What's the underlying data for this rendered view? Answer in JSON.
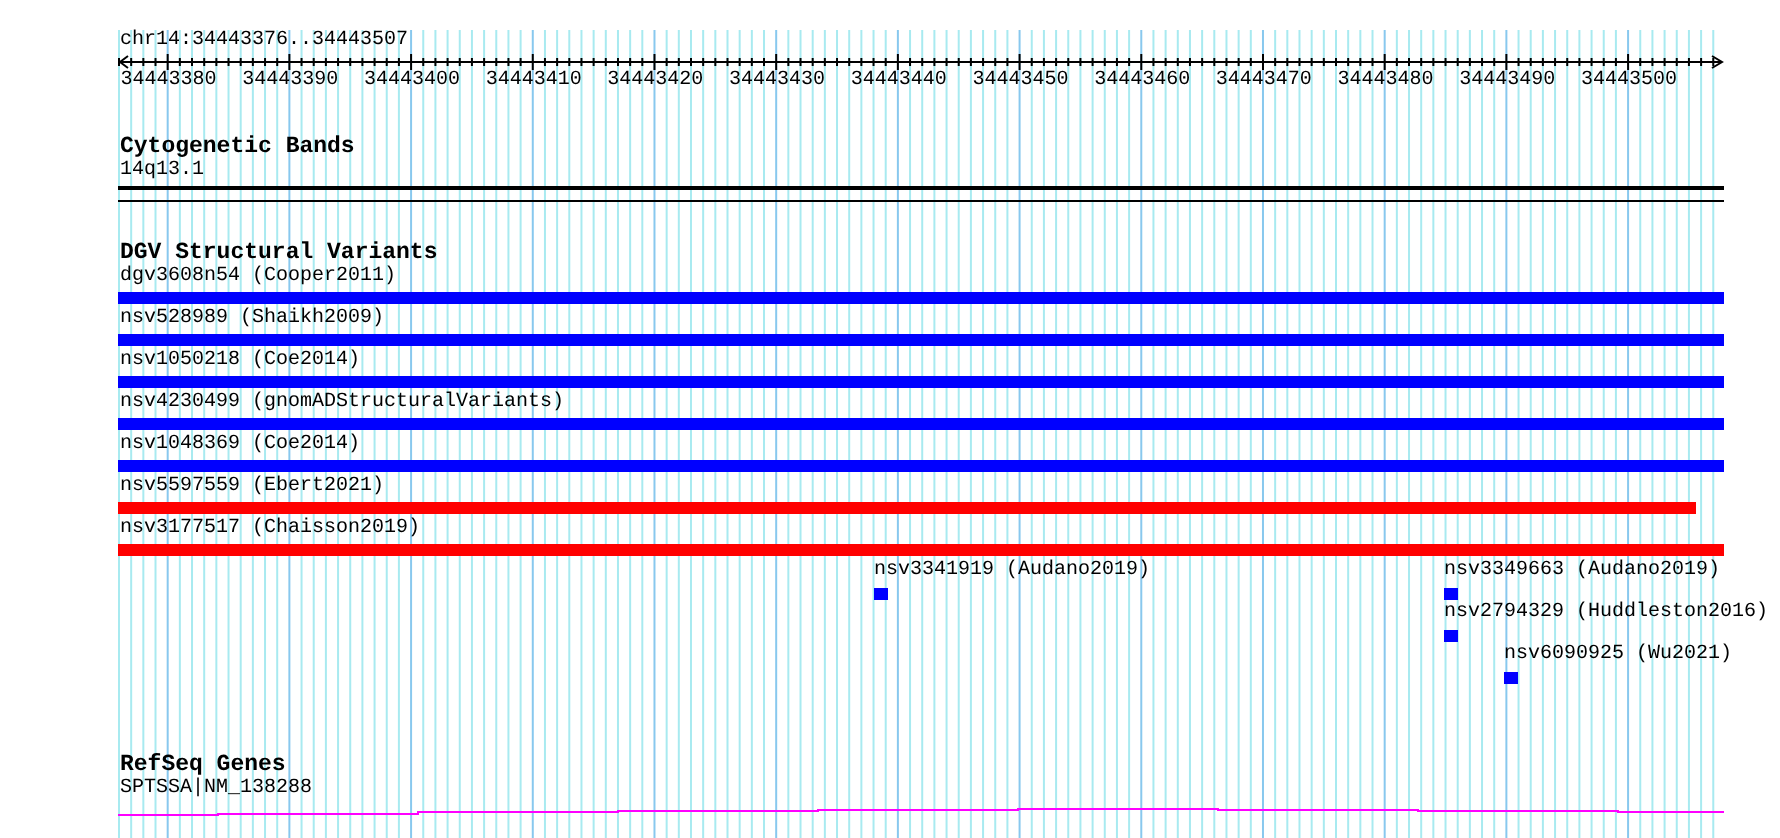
{
  "ruler": {
    "range": "chr14:34443376..34443507",
    "ticks": [
      "34443380",
      "34443390",
      "34443400",
      "34443410",
      "34443420",
      "34443430",
      "34443440",
      "34443450",
      "34443460",
      "34443470",
      "34443480",
      "34443490",
      "34443500"
    ]
  },
  "tracks": [
    {
      "kind": "cytoband",
      "title": "Cytogenetic Bands",
      "features": [
        {
          "label": "14q13.1"
        }
      ]
    },
    {
      "kind": "variants",
      "title": "DGV Structural Variants",
      "features": [
        {
          "kind": "bar",
          "label": "dgv3608n54 (Cooper2011)",
          "color": "#0000ff"
        },
        {
          "kind": "bar",
          "label": "nsv528989 (Shaikh2009)",
          "color": "#0000ff"
        },
        {
          "kind": "bar",
          "label": "nsv1050218 (Coe2014)",
          "color": "#0000ff"
        },
        {
          "kind": "bar",
          "label": "nsv4230499 (gnomADStructuralVariants)",
          "color": "#0000ff"
        },
        {
          "kind": "bar",
          "label": "nsv1048369 (Coe2014)",
          "color": "#0000ff"
        },
        {
          "kind": "bar",
          "label": "nsv5597559 (Ebert2021)",
          "color": "#ff0000"
        },
        {
          "kind": "bar",
          "label": "nsv3177517 (Chaisson2019)",
          "color": "#ff0000"
        },
        {
          "kind": "point",
          "label": "nsv3341919 (Audano2019)",
          "color": "#0000ff"
        },
        {
          "kind": "point",
          "label": "nsv3349663 (Audano2019)",
          "color": "#0000ff"
        },
        {
          "kind": "point",
          "label": "nsv2794329 (Huddleston2016)",
          "color": "#0000ff"
        },
        {
          "kind": "point",
          "label": "nsv6090925 (Wu2021)",
          "color": "#0000ff"
        }
      ]
    },
    {
      "kind": "genes",
      "title": "RefSeq Genes",
      "features": [
        {
          "label": "SPTSSA|NM_138288"
        }
      ]
    }
  ]
}
